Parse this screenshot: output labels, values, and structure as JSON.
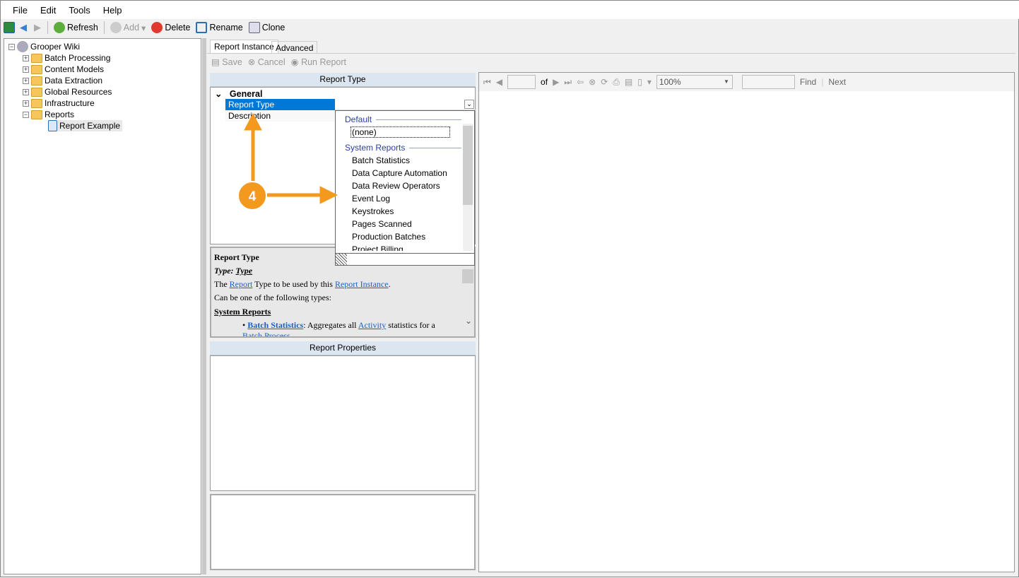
{
  "menu": [
    "File",
    "Edit",
    "Tools",
    "Help"
  ],
  "toolbar": {
    "refresh": "Refresh",
    "add": "Add",
    "delete": "Delete",
    "rename": "Rename",
    "clone": "Clone"
  },
  "tree": {
    "root": "Grooper Wiki",
    "items": [
      "Batch Processing",
      "Content Models",
      "Data Extraction",
      "Global Resources",
      "Infrastructure",
      "Reports"
    ],
    "child": "Report Example"
  },
  "tabs": [
    "Report Instance",
    "Advanced"
  ],
  "actions": {
    "save": "Save",
    "cancel": "Cancel",
    "run": "Run Report"
  },
  "report_type_header": "Report Type",
  "grid": {
    "category": "General",
    "rows": [
      "Report Type",
      "Description"
    ]
  },
  "dropdown": {
    "groups": [
      {
        "label": "Default",
        "items": [
          "(none)"
        ]
      },
      {
        "label": "System Reports",
        "items": [
          "Batch Statistics",
          "Data Capture Automation",
          "Data Review Operators",
          "Event Log",
          "Keystrokes",
          "Pages Scanned",
          "Production Batches",
          "Project Billing"
        ]
      }
    ]
  },
  "help": {
    "title": "Report Type",
    "type_label": "Type:",
    "type_value": "Type",
    "line1_a": "The ",
    "line1_link1": "Report",
    "line1_b": " Type to be used by this ",
    "line1_link2": "Report Instance",
    "line1_c": ".",
    "line2": "Can be one of the following types:",
    "section": "System Reports",
    "bullet_link": "Batch Statistics",
    "bullet_a": ": Aggregates all ",
    "bullet_link2": "Activity",
    "bullet_b": " statistics for a ",
    "bullet_link3": "Batch Process",
    "bullet_c": "."
  },
  "report_properties_header": "Report Properties",
  "viewer": {
    "of": "of",
    "zoom": "100%",
    "find": "Find",
    "next": "Next"
  },
  "callout": {
    "number": "4",
    "color": "#f39a1e"
  }
}
